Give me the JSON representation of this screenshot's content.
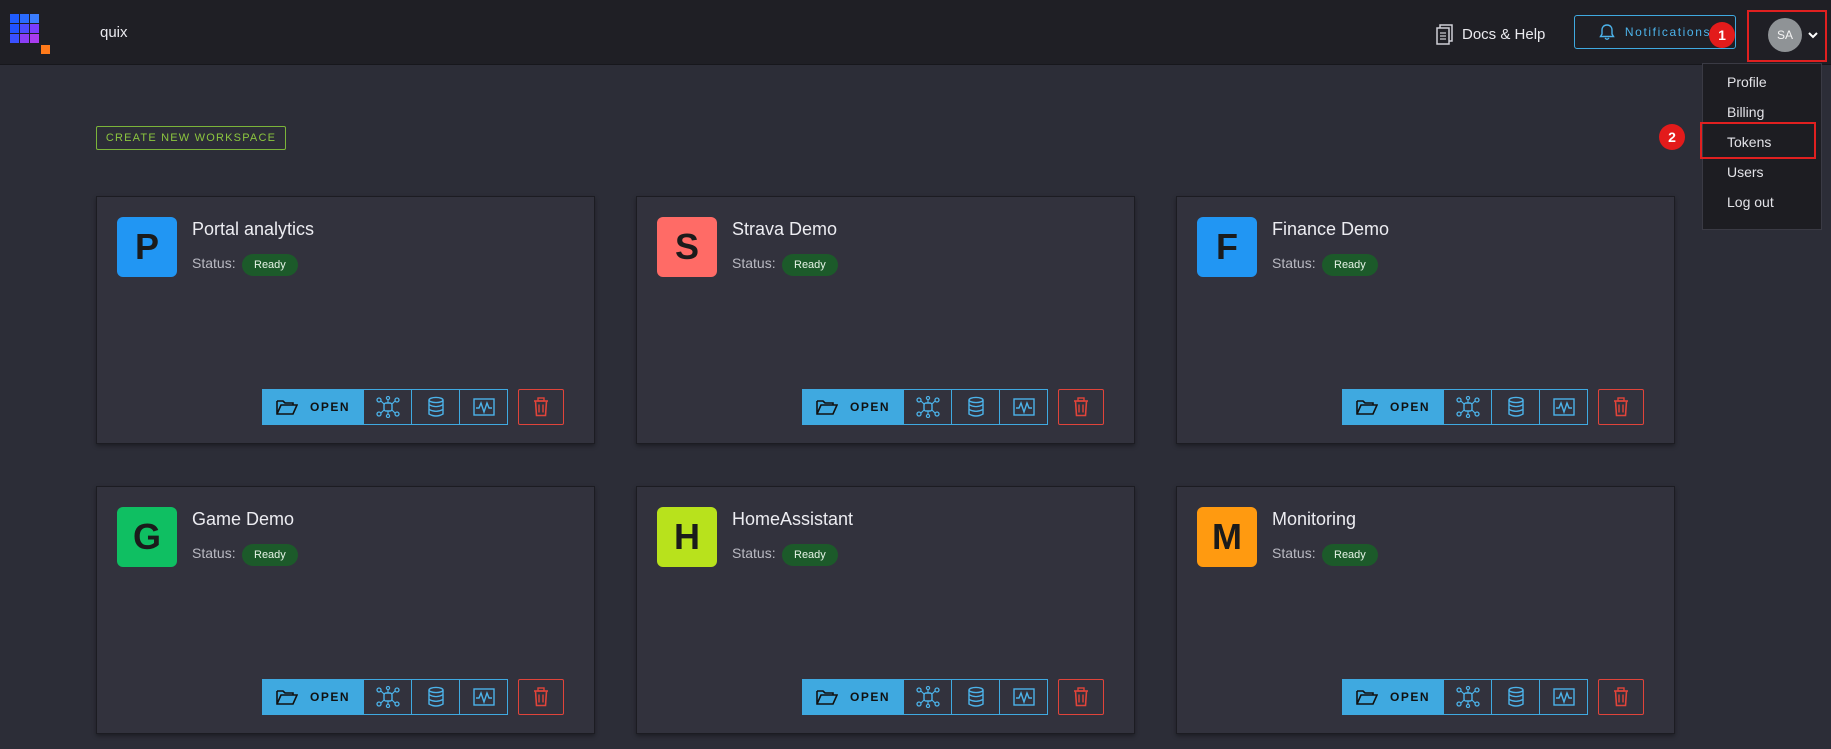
{
  "app": {
    "name": "quix"
  },
  "header": {
    "docs_label": "Docs & Help",
    "notifications_label": "Notifications",
    "avatar_initials": "SA",
    "step1": "1",
    "step2": "2"
  },
  "user_menu": {
    "items": [
      "Profile",
      "Billing",
      "Tokens",
      "Users",
      "Log out"
    ]
  },
  "create_label": "CREATE NEW WORKSPACE",
  "workspaces": [
    {
      "letter": "P",
      "name": "Portal analytics",
      "status_label": "Status:",
      "status": "Ready",
      "color": "#2196f3",
      "open_label": "OPEN"
    },
    {
      "letter": "S",
      "name": "Strava Demo",
      "status_label": "Status:",
      "status": "Ready",
      "color": "#ff6b66",
      "open_label": "OPEN"
    },
    {
      "letter": "F",
      "name": "Finance Demo",
      "status_label": "Status:",
      "status": "Ready",
      "color": "#2196f3",
      "open_label": "OPEN"
    },
    {
      "letter": "G",
      "name": "Game Demo",
      "status_label": "Status:",
      "status": "Ready",
      "color": "#0fbf62",
      "open_label": "OPEN"
    },
    {
      "letter": "H",
      "name": "HomeAssistant",
      "status_label": "Status:",
      "status": "Ready",
      "color": "#b8e21c",
      "open_label": "OPEN"
    },
    {
      "letter": "M",
      "name": "Monitoring",
      "status_label": "Status:",
      "status": "Ready",
      "color": "#ff9a10",
      "open_label": "OPEN"
    }
  ],
  "colors": {
    "accent": "#3fa9e0",
    "danger": "#e0443a",
    "create": "#8cc63f",
    "status_badge": "#1c5a2a",
    "highlight": "#e02020"
  },
  "icons": [
    "folder-icon",
    "topology-icon",
    "database-icon",
    "waveform-icon",
    "trash-icon",
    "bell-icon",
    "docs-icon",
    "chevron-down-icon"
  ]
}
